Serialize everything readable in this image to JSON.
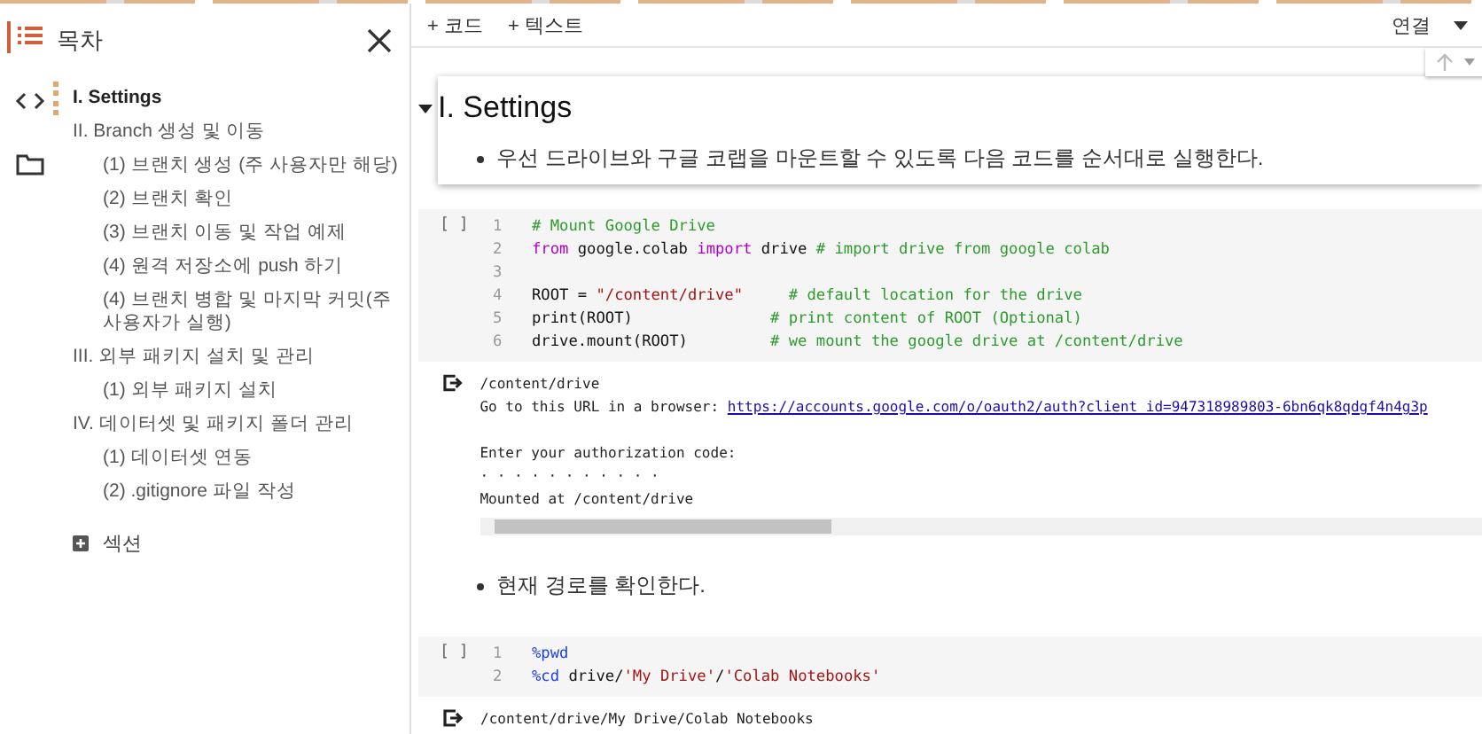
{
  "sidebar": {
    "title": "목차",
    "tools": [
      {
        "selected": true
      },
      {
        "selected": false
      },
      {
        "selected": false
      }
    ],
    "toc": [
      {
        "label": "I. Settings",
        "selected": true
      },
      {
        "label": "II. Branch 생성 및 이동",
        "selected": false,
        "children": [
          {
            "label": "(1) 브랜치 생성 (주 사용자만 해당)",
            "selected": false
          },
          {
            "label": "(2) 브랜치 확인",
            "selected": false
          },
          {
            "label": "(3) 브랜치 이동 및 작업 예제",
            "selected": false
          },
          {
            "label": "(4) 원격 저장소에 push 하기",
            "selected": false
          },
          {
            "label": "(4) 브랜치 병합 및 마지막 커밋(주 사용자가 실행)",
            "selected": false
          }
        ]
      },
      {
        "label": "III. 외부 패키지 설치 및 관리",
        "selected": false,
        "children": [
          {
            "label": "(1) 외부 패키지 설치",
            "selected": false
          }
        ]
      },
      {
        "label": "IV. 데이터셋 및 패키지 폴더 관리",
        "selected": false,
        "children": [
          {
            "label": "(1) 데이터셋 연동",
            "selected": false
          },
          {
            "label": "(2) .gitignore 파일 작성",
            "selected": false
          }
        ]
      }
    ],
    "add_section": "섹션"
  },
  "toolbar": {
    "buttons": [
      "+ 코드",
      "+ 텍스트"
    ],
    "connect": "연결"
  },
  "cells": [
    {
      "kind": "text",
      "heading": "I. Settings",
      "bullet": "우선 드라이브와 구글 코랩을 마운트할 수 있도록 다음 코드를 순서대로 실행한다.",
      "selected": true
    },
    {
      "kind": "code",
      "run": "[ ]",
      "lines": [
        {
          "no": "1",
          "tokens": [
            {
              "kind": "comment",
              "text": "# Mount Google Drive"
            }
          ]
        },
        {
          "no": "2",
          "tokens": [
            {
              "kind": "keyword",
              "text": "from"
            },
            {
              "kind": "plain",
              "text": " google.colab "
            },
            {
              "kind": "keyword",
              "text": "import"
            },
            {
              "kind": "plain",
              "text": " drive "
            },
            {
              "kind": "comment",
              "text": "# import drive from google colab"
            }
          ]
        },
        {
          "no": "3"
        },
        {
          "no": "4",
          "tokens": [
            {
              "kind": "plain",
              "text": "ROOT = "
            },
            {
              "kind": "string",
              "text": "\"/content/drive\""
            },
            {
              "kind": "comment",
              "text": "     # default location for the drive"
            }
          ]
        },
        {
          "no": "5",
          "tokens": [
            {
              "kind": "plain",
              "text": "print(ROOT)               "
            },
            {
              "kind": "comment",
              "text": "# print content of ROOT (Optional)"
            }
          ]
        },
        {
          "no": "6",
          "tokens": [
            {
              "kind": "plain",
              "text": "drive.mount(ROOT)         "
            },
            {
              "kind": "comment",
              "text": "# we mount the google drive at /content/drive"
            }
          ]
        }
      ],
      "output": [
        {
          "text": "/content/drive"
        },
        {
          "text": "Go to this URL in a browser: ",
          "link": "https://accounts.google.com/o/oauth2/auth?client_id=947318989803-6bn6qk8qdgf4n4g3p"
        },
        {
          "text": "Enter your authorization code:",
          "space_before": true
        },
        {
          "text": "· · · · · · · · · · ·"
        },
        {
          "text": "Mounted at /content/drive"
        }
      ],
      "scrollbar": true
    },
    {
      "kind": "text",
      "bullet": "현재 경로를 확인한다.",
      "selected": false
    },
    {
      "kind": "code",
      "run": "[ ]",
      "lines": [
        {
          "no": "1",
          "tokens": [
            {
              "kind": "magic",
              "text": "%pwd"
            }
          ]
        },
        {
          "no": "2",
          "tokens": [
            {
              "kind": "magic",
              "text": "%cd"
            },
            {
              "kind": "plain",
              "text": " drive/"
            },
            {
              "kind": "string",
              "text": "'My Drive'"
            },
            {
              "kind": "plain",
              "text": "/"
            },
            {
              "kind": "string",
              "text": "'Colab Notebooks'"
            }
          ]
        }
      ],
      "output": [
        {
          "text": "/content/drive/My Drive/Colab Notebooks"
        }
      ]
    }
  ]
}
